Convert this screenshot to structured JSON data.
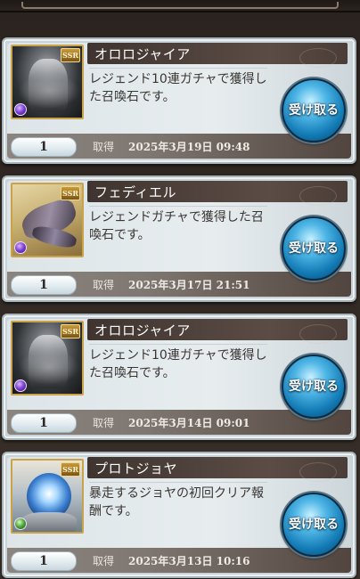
{
  "items": [
    {
      "name": "オロロジャイア",
      "description": "レジェンド10連ガチャで獲得した召喚石です。",
      "quantity": "1",
      "acquired_label": "取得",
      "date": "2025年3月19日 09:48",
      "rarity": "SSR",
      "element": "dark",
      "button_label": "受け取る"
    },
    {
      "name": "フェディエル",
      "description": "レジェンドガチャで獲得した召喚石です。",
      "quantity": "1",
      "acquired_label": "取得",
      "date": "2025年3月17日 21:51",
      "rarity": "SSR",
      "element": "dark",
      "button_label": "受け取る"
    },
    {
      "name": "オロロジャイア",
      "description": "レジェンド10連ガチャで獲得した召喚石です。",
      "quantity": "1",
      "acquired_label": "取得",
      "date": "2025年3月14日 09:01",
      "rarity": "SSR",
      "element": "dark",
      "button_label": "受け取る"
    },
    {
      "name": "プロトジョヤ",
      "description": "暴走するジョヤの初回クリア報酬です。",
      "quantity": "1",
      "acquired_label": "取得",
      "date": "2025年3月13日 10:16",
      "rarity": "SSR",
      "element": "wind",
      "button_label": "受け取る"
    }
  ]
}
